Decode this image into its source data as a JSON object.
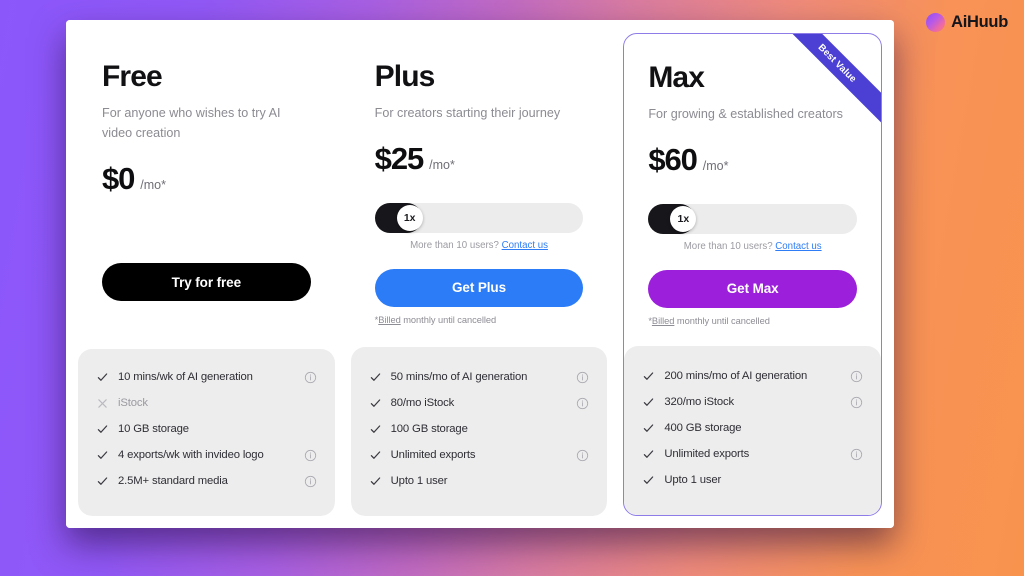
{
  "brand": {
    "name": "AiHuub",
    "mark": "gradient-circle-logo"
  },
  "ribbon": {
    "label": "Best Value"
  },
  "plans": [
    {
      "id": "free",
      "name": "Free",
      "description": "For anyone who wishes to try AI video creation",
      "price": "$0",
      "period": "/mo*",
      "has_slider": false,
      "cta_label": "Try for free",
      "cta_style": "dark",
      "cta_note": "",
      "features": [
        {
          "mark": "check",
          "label": "10 mins/wk of AI generation",
          "info": true
        },
        {
          "mark": "cross",
          "label": "iStock",
          "info": false
        },
        {
          "mark": "check",
          "label": "10 GB storage",
          "info": false
        },
        {
          "mark": "check",
          "label": "4 exports/wk with invideo logo",
          "info": true
        },
        {
          "mark": "check",
          "label": "2.5M+ standard media",
          "info": true
        }
      ]
    },
    {
      "id": "plus",
      "name": "Plus",
      "description": "For creators starting their journey",
      "price": "$25",
      "period": "/mo*",
      "has_slider": true,
      "slider_value": "1x",
      "slider_note_text": "More than 10 users?",
      "slider_note_link": "Contact us",
      "cta_label": "Get Plus",
      "cta_style": "blue",
      "cta_note_prefix": "*",
      "cta_note_underlined": "Billed",
      "cta_note_rest": " monthly until cancelled",
      "features": [
        {
          "mark": "check",
          "label": "50 mins/mo of AI generation",
          "info": true
        },
        {
          "mark": "check",
          "label": "80/mo iStock",
          "info": true
        },
        {
          "mark": "check",
          "label": "100 GB storage",
          "info": false
        },
        {
          "mark": "check",
          "label": "Unlimited exports",
          "info": true
        },
        {
          "mark": "check",
          "label": "Upto 1 user",
          "info": false
        }
      ]
    },
    {
      "id": "max",
      "name": "Max",
      "description": "For growing & established creators",
      "price": "$60",
      "period": "/mo*",
      "has_slider": true,
      "slider_value": "1x",
      "slider_note_text": "More than 10 users?",
      "slider_note_link": "Contact us",
      "cta_label": "Get Max",
      "cta_style": "purple",
      "cta_note_prefix": "*",
      "cta_note_underlined": "Billed",
      "cta_note_rest": " monthly until cancelled",
      "highlighted": true,
      "badge": "Best Value",
      "features": [
        {
          "mark": "check",
          "label": "200 mins/mo of AI generation",
          "info": true
        },
        {
          "mark": "check",
          "label": "320/mo iStock",
          "info": true
        },
        {
          "mark": "check",
          "label": "400 GB storage",
          "info": false
        },
        {
          "mark": "check",
          "label": "Unlimited exports",
          "info": true
        },
        {
          "mark": "check",
          "label": "Upto 1 user",
          "info": false
        }
      ]
    }
  ],
  "colors": {
    "background_start": "#8b57fb",
    "background_end": "#f8934e",
    "free_cta": "#000000",
    "plus_cta": "#2b7cf6",
    "max_cta": "#9b1fdb",
    "ribbon": "#4b3fd4",
    "highlight_border": "#8e7de8",
    "link": "#2f7df6",
    "feature_panel": "#ededed"
  }
}
